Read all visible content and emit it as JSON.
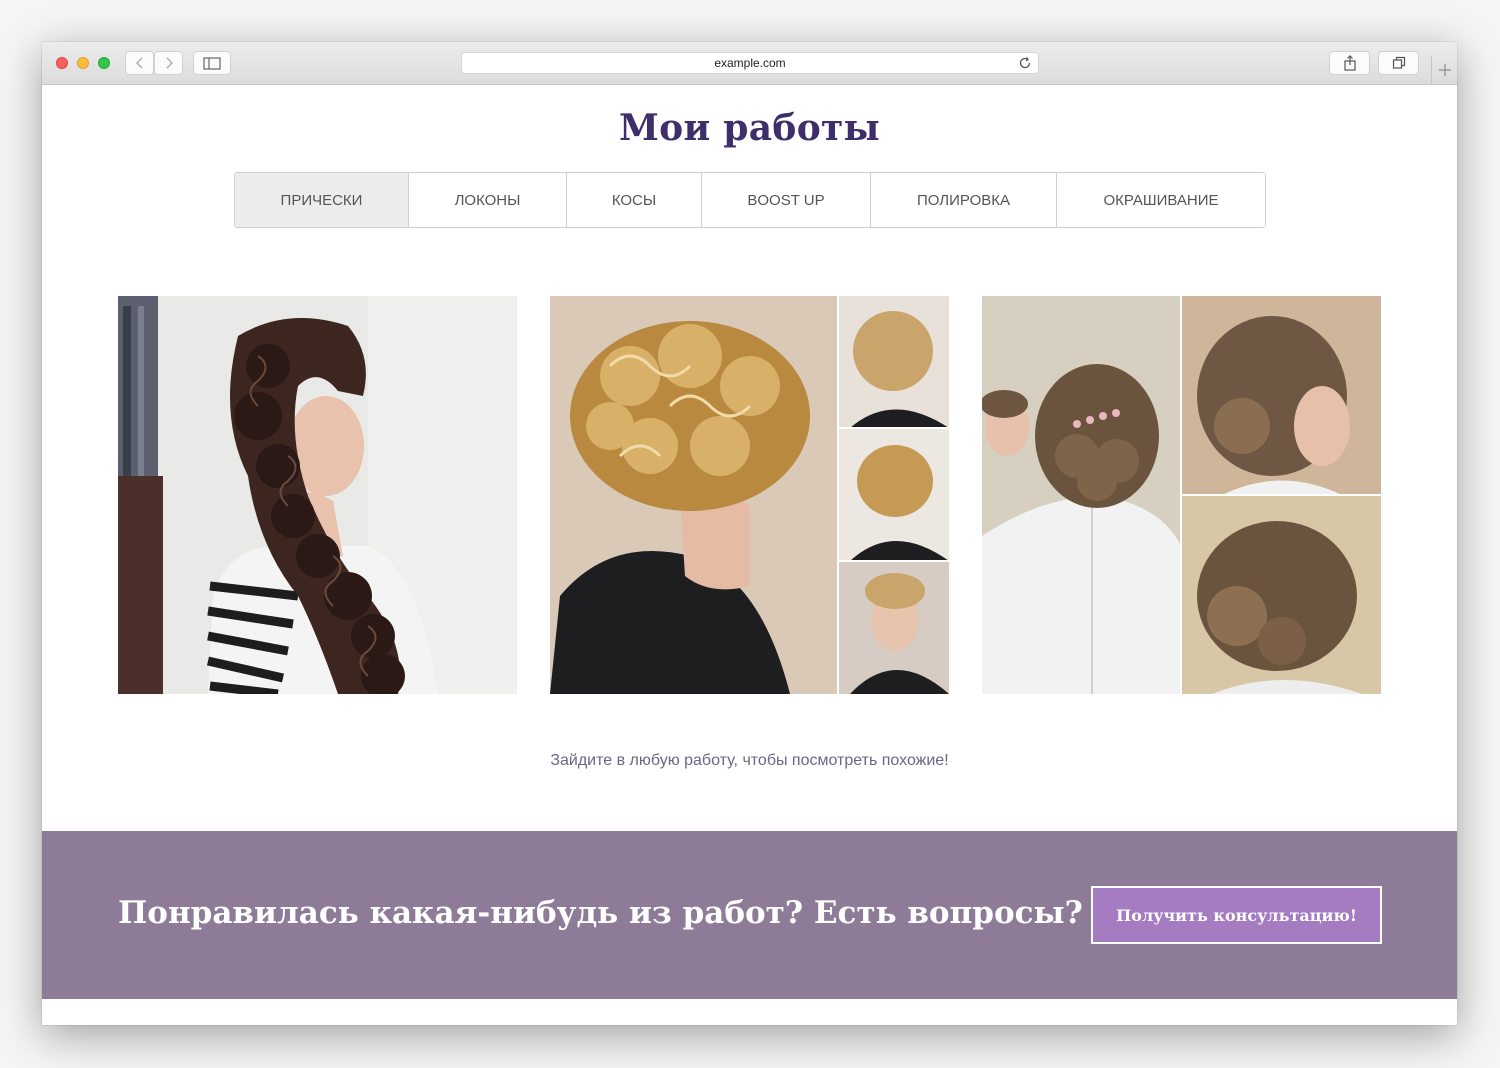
{
  "browser": {
    "url": "example.com"
  },
  "page": {
    "title": "Мои работы",
    "tabs": [
      {
        "label": "ПРИЧЕСКИ",
        "active": true
      },
      {
        "label": "ЛОКОНЫ",
        "active": false
      },
      {
        "label": "КОСЫ",
        "active": false
      },
      {
        "label": "BOOST UP",
        "active": false
      },
      {
        "label": "ПОЛИРОВКА",
        "active": false
      },
      {
        "label": "ОКРАШИВАНИЕ",
        "active": false
      }
    ],
    "hint": "Зайдите в любую работу, чтобы посмотреть похожие!"
  },
  "cta": {
    "text": "Понравилась какая-нибудь из работ? Есть вопросы?",
    "button_label": "Получить консультацию!"
  },
  "colors": {
    "title": "#3e2f6b",
    "cta_background": "#8d7b97",
    "cta_button": "#a57cc2",
    "hint": "#6b6688"
  }
}
